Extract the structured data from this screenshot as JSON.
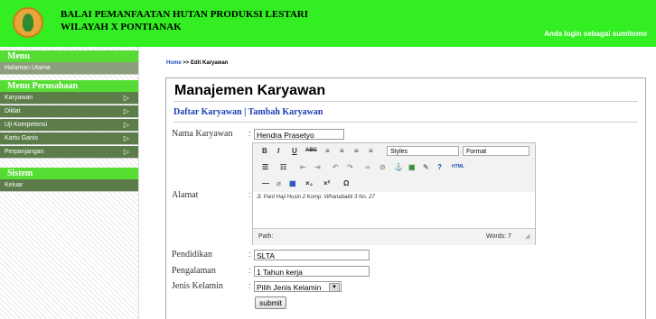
{
  "header": {
    "institution_line1": "BALAI PEMANFAATAN HUTAN PRODUKSI LESTARI",
    "institution_line2": "WILAYAH X PONTIANAK",
    "login_text": "Anda login sebagai sumitomo"
  },
  "sidebar": {
    "menu_title": "Menu",
    "menu_items": [
      "Halaman Utama"
    ],
    "company_title": "Menu Perusahaan",
    "company_items": [
      "Karyawan",
      "Diklat",
      "Uji Kompetensi",
      "Kartu Ganis",
      "Perpanjangan"
    ],
    "system_title": "Sistem",
    "system_items": [
      "Keluar"
    ]
  },
  "breadcrumb": {
    "home": "Home",
    "separator": ">>",
    "current": "Edit Karyawan"
  },
  "page": {
    "title": "Manajemen Karyawan",
    "link_list": "Daftar Karyawan",
    "link_sep": "|",
    "link_add": "Tambah Karyawan"
  },
  "form": {
    "nama_label": "Nama Karyawan",
    "nama_value": "Hendra Prasetyo",
    "alamat_label": "Alamat",
    "alamat_value": "Jl. Parit Haji Husin 2 Komp. Whanabakti 3 No. 27",
    "pendidikan_label": "Pendidikan",
    "pendidikan_value": "SLTA",
    "pengalaman_label": "Pengalaman",
    "pengalaman_value": "1 Tahun kerja",
    "jk_label": "Jenis Kelamin",
    "jk_selected": "Pilih Jenis Kelamin",
    "submit_label": "submit",
    "colon": ":"
  },
  "editor": {
    "styles_label": "Styles",
    "format_label": "Format",
    "html_label": "HTML",
    "path_label": "Path:",
    "words_label": "Words: 7"
  },
  "colors": {
    "header": "#33ee22",
    "sidebar_item": "#5c7d4a",
    "link": "#1a3fb5"
  }
}
